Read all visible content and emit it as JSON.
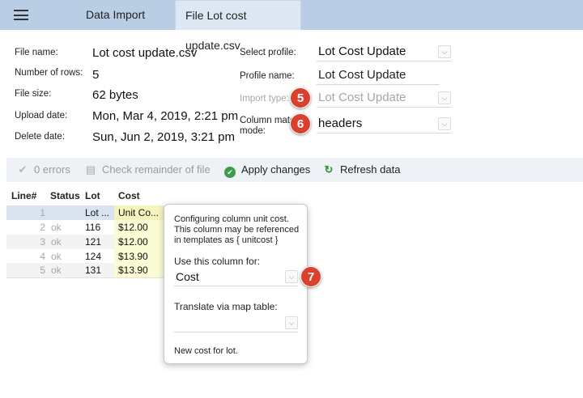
{
  "topbar": {
    "menu_icon": "hamburger-menu-icon",
    "tabs": [
      {
        "label": "Data Import"
      },
      {
        "label": "File Lot cost update.csv"
      }
    ]
  },
  "file_info": {
    "file_name_label": "File name:",
    "file_name": "Lot cost update.csv",
    "rows_label": "Number of rows:",
    "rows": "5",
    "size_label": "File size:",
    "size": "62 bytes",
    "upload_label": "Upload date:",
    "upload": "Mon, Mar 4, 2019, 2:21 pm",
    "delete_label": "Delete date:",
    "delete": "Sun, Jun 2, 2019, 3:21 pm"
  },
  "settings": {
    "profile_label": "Select profile:",
    "profile": "Lot Cost Update",
    "profile_name_label": "Profile name:",
    "profile_name": "Lot Cost Update",
    "import_type_label": "Import type:",
    "import_type": "Lot Cost Update",
    "column_match_label_1": "Column match",
    "column_match_label_2": "mode:",
    "column_match": "headers"
  },
  "badges": {
    "b5": "5",
    "b6": "6",
    "b7": "7"
  },
  "toolbar": {
    "errors": "0 errors",
    "check": "Check remainder of file",
    "apply": "Apply changes",
    "refresh": "Refresh data"
  },
  "table": {
    "headers": [
      "Line#",
      "Status",
      "Lot",
      "Cost"
    ],
    "rows": [
      {
        "line": "1",
        "status": "",
        "lot": "Lot ...",
        "cost": "Unit Co..."
      },
      {
        "line": "2",
        "status": "ok",
        "lot": "116",
        "cost": "$12.00"
      },
      {
        "line": "3",
        "status": "ok",
        "lot": "121",
        "cost": "$12.00"
      },
      {
        "line": "4",
        "status": "ok",
        "lot": "124",
        "cost": "$13.90"
      },
      {
        "line": "5",
        "status": "ok",
        "lot": "131",
        "cost": "$13.90"
      }
    ]
  },
  "popup": {
    "description": "Configuring column unit cost. This column may be referenced in templates as { unitcost }",
    "use_label": "Use this column for:",
    "use_value": "Cost",
    "translate_label": "Translate via map table:",
    "translate_value": "",
    "note": "New cost for lot."
  }
}
